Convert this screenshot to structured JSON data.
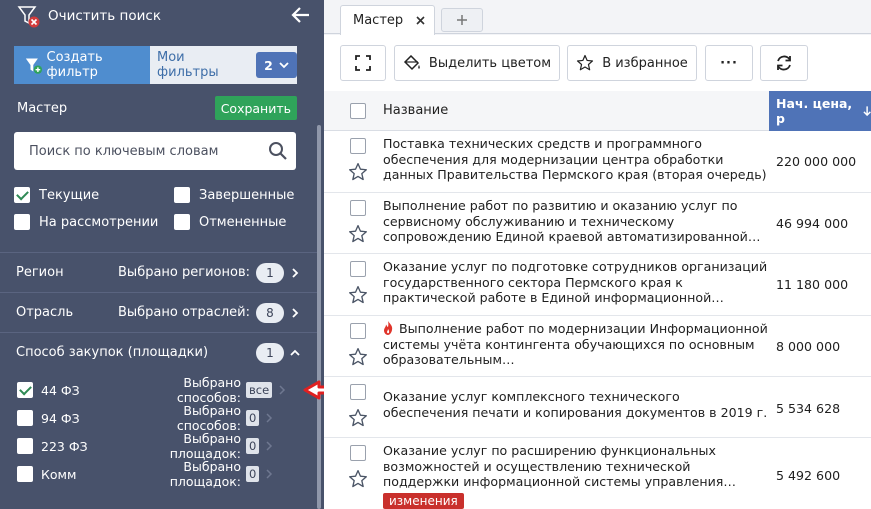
{
  "sidebar": {
    "clear_search": "Очистить поиск",
    "create_filter": "Создать фильтр",
    "my_filters": "Мои фильтры",
    "my_filters_count": "2",
    "filter_name": "Мастер",
    "save": "Сохранить",
    "search_placeholder": "Поиск по ключевым словам",
    "statuses": [
      {
        "label": "Текущие",
        "checked": true
      },
      {
        "label": "Завершенные",
        "checked": false
      },
      {
        "label": "На рассмотрении",
        "checked": false
      },
      {
        "label": "Отмененные",
        "checked": false
      }
    ],
    "sections": [
      {
        "label": "Регион",
        "summary": "Выбрано регионов:",
        "count": "1"
      },
      {
        "label": "Отрасль",
        "summary": "Выбрано отраслей:",
        "count": "8"
      },
      {
        "label": "Способ закупок (площадки)",
        "summary": "",
        "count": "1"
      }
    ],
    "laws": [
      {
        "name": "44 ФЗ",
        "summary": "Выбрано способов:",
        "value": "все",
        "checked": true
      },
      {
        "name": "94 ФЗ",
        "summary": "Выбрано способов:",
        "value": "0",
        "checked": false
      },
      {
        "name": "223 ФЗ",
        "summary": "Выбрано площадок:",
        "value": "0",
        "checked": false
      },
      {
        "name": "Комм",
        "summary": "Выбрано площадок:",
        "value": "0",
        "checked": false
      }
    ]
  },
  "tabs": [
    {
      "label": "Мастер"
    }
  ],
  "toolbar": {
    "highlight": "Выделить цветом",
    "favorites": "В избранное",
    "more": "···"
  },
  "table": {
    "col_name": "Название",
    "col_price": "Нач. цена, р",
    "rows": [
      {
        "title": "Поставка технических средств и программного обеспечения для модернизации центра обработки данных Правительства Пермского края (вторая очередь)",
        "price": "220 000 000"
      },
      {
        "title": "Выполнение работ по развитию и оказанию услуг по сервисному обслуживанию и техническому сопровождению Единой краевой автоматизированной…",
        "price": "46 994 000"
      },
      {
        "title": "Оказание услуг по подготовке сотрудников организаций государственного сектора Пермского края к практической работе в Единой информационной…",
        "price": "11 180 000"
      },
      {
        "title": "Выполнение работ по модернизации Информационной системы учёта контингента обучающихся по основным образовательным…",
        "price": "8 000 000",
        "hot": true
      },
      {
        "title": "Оказание услуг комплексного технического обеспечения печати и копирования документов в 2019 г.",
        "price": "5 534 628"
      },
      {
        "title": "Оказание услуг по расширению функциональных возможностей и осуществлению технической поддержки информационной системы управления…",
        "price": "5 492 600",
        "badge": "изменения"
      }
    ]
  },
  "colors": {
    "sidebar_bg": "#48526b",
    "accent_blue": "#4f73b7",
    "save_green": "#2fa35a",
    "changes_red": "#c9302c"
  }
}
